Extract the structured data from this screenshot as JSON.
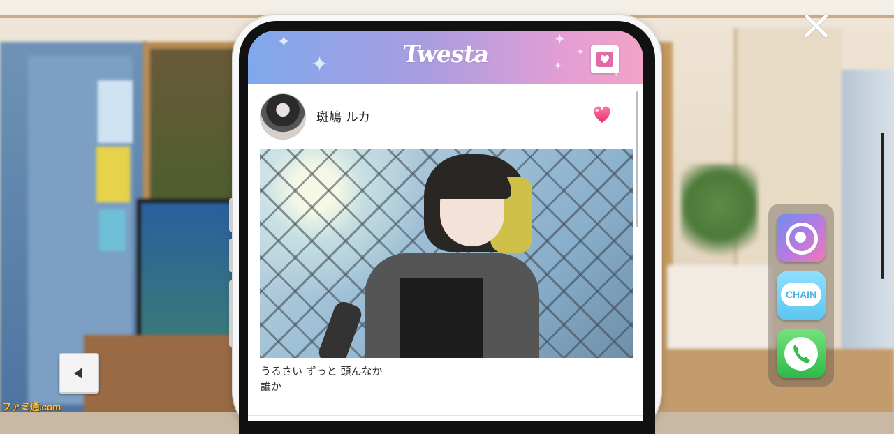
{
  "app": {
    "name": "Twesta",
    "header_gradient": [
      "#7fa8ec",
      "#f2a3c7"
    ]
  },
  "post": {
    "username": "斑鳩 ルカ",
    "liked": true,
    "caption_lines": [
      "うるさい ずっと 頭んなか",
      "誰か"
    ]
  },
  "dock": {
    "apps": [
      {
        "name": "camera-app",
        "icon": "camera-icon"
      },
      {
        "name": "chain-app",
        "label": "CHAIN",
        "icon": "chat-bubble-icon"
      },
      {
        "name": "phone-app",
        "icon": "phone-icon"
      }
    ]
  },
  "controls": {
    "close_icon": "close-icon",
    "back_icon": "triangle-left-icon",
    "favorite_icon": "heart-icon"
  },
  "watermark": "ファミ通.com",
  "colors": {
    "heart": "#ec3f7a",
    "accent_blue": "#7fa8ec",
    "accent_pink": "#f2a3c7"
  }
}
